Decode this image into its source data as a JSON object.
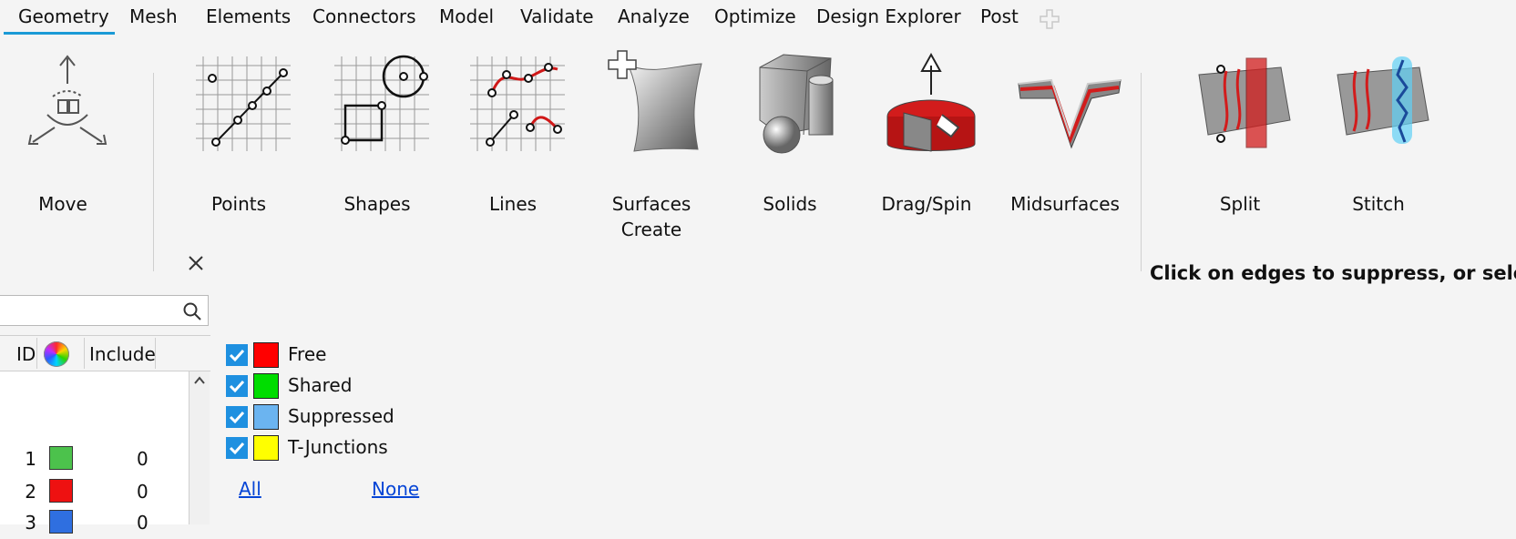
{
  "tabs": [
    {
      "label": "Geometry",
      "active": true
    },
    {
      "label": "Mesh"
    },
    {
      "label": "Elements"
    },
    {
      "label": "Connectors"
    },
    {
      "label": "Model"
    },
    {
      "label": "Validate"
    },
    {
      "label": "Analyze"
    },
    {
      "label": "Optimize"
    },
    {
      "label": "Design Explorer"
    },
    {
      "label": "Post"
    }
  ],
  "ribbon": {
    "tools": [
      {
        "label": "Move",
        "icon": "move-icon"
      },
      {
        "label": "Points",
        "icon": "points-icon"
      },
      {
        "label": "Shapes",
        "icon": "shapes-icon"
      },
      {
        "label": "Lines",
        "icon": "lines-icon"
      },
      {
        "label": "Surfaces\nCreate",
        "icon": "surfaces-icon"
      },
      {
        "label": "Solids",
        "icon": "solids-icon"
      },
      {
        "label": "Drag/Spin",
        "icon": "drag-spin-icon"
      },
      {
        "label": "Midsurfaces",
        "icon": "midsurfaces-icon"
      },
      {
        "label": "Split",
        "icon": "split-icon"
      },
      {
        "label": "Stitch",
        "icon": "stitch-icon"
      }
    ]
  },
  "panel": {
    "search_placeholder": "",
    "columns": {
      "id": "ID",
      "include": "Include"
    },
    "rows": [
      {
        "id": "1",
        "color": "#4cc24c",
        "include": "0"
      },
      {
        "id": "2",
        "color": "#ee1111",
        "include": "0"
      },
      {
        "id": "3",
        "color": "#2f6fe0",
        "include": "0"
      }
    ]
  },
  "legend": {
    "items": [
      {
        "label": "Free",
        "color": "#ff0000",
        "checked": true
      },
      {
        "label": "Shared",
        "color": "#00dd00",
        "checked": true
      },
      {
        "label": "Suppressed",
        "color": "#6bb4f0",
        "checked": true
      },
      {
        "label": "T-Junctions",
        "color": "#ffff00",
        "checked": true
      }
    ],
    "all_label": "All",
    "none_label": "None"
  },
  "instruction": "Click on edges to suppress, or sele"
}
